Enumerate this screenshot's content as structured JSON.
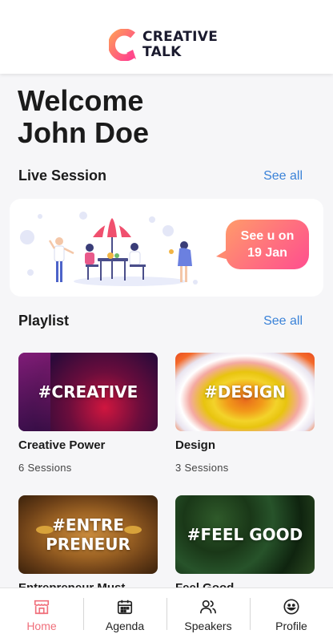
{
  "app": {
    "logo_line1": "CREATIVE",
    "logo_line2": "TALK"
  },
  "welcome": {
    "line1": "Welcome",
    "line2": "John Doe"
  },
  "live_session": {
    "title": "Live Session",
    "see_all": "See all",
    "bubble_line1": "See u on",
    "bubble_line2": "19 Jan"
  },
  "playlist": {
    "title": "Playlist",
    "see_all": "See all",
    "items": [
      {
        "tag": "#CREATIVE",
        "title": "Creative Power",
        "sessions": "6 Sessions"
      },
      {
        "tag": "#DESIGN",
        "title": "Design",
        "sessions": "3 Sessions"
      },
      {
        "tag_line1": "#ENTRE",
        "tag_line2": "PRENEUR",
        "title": "Entrepreneur Must",
        "sessions": ""
      },
      {
        "tag": "#FEEL GOOD",
        "title": "Feel Good",
        "sessions": ""
      }
    ]
  },
  "tabs": [
    {
      "label": "Home",
      "icon": "store-icon",
      "active": true
    },
    {
      "label": "Agenda",
      "icon": "calendar-icon",
      "active": false
    },
    {
      "label": "Speakers",
      "icon": "people-icon",
      "active": false
    },
    {
      "label": "Profile",
      "icon": "smiley-icon",
      "active": false
    }
  ],
  "colors": {
    "accent": "#f06f7b",
    "link": "#3a82d8",
    "bubble_start": "#ff9b6a",
    "bubble_end": "#ff4e8f"
  }
}
